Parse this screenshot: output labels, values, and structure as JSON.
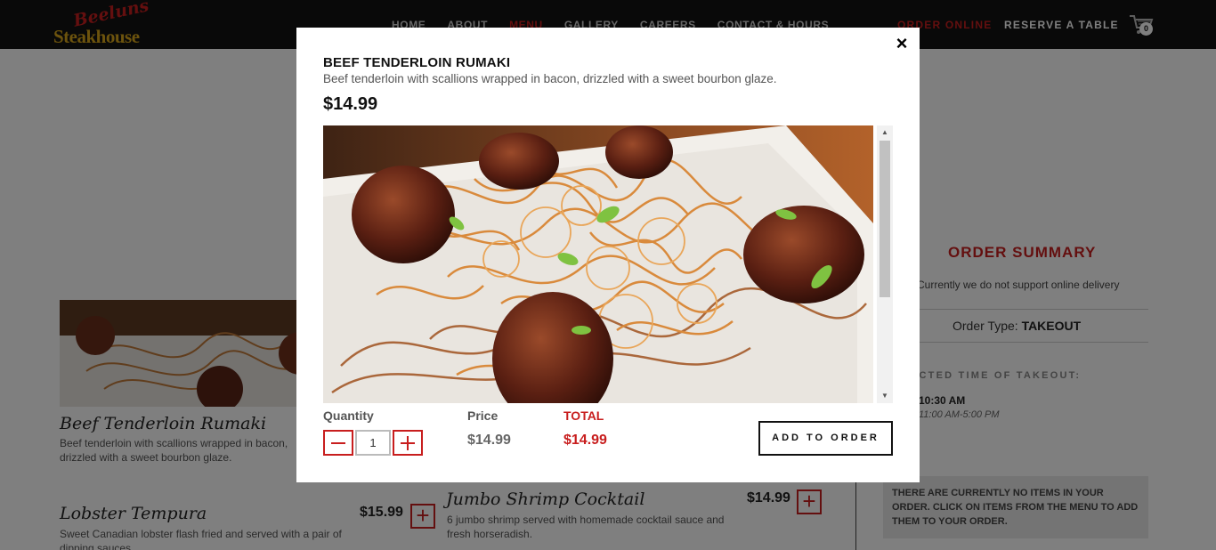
{
  "site": {
    "logo_script": "Beeluns",
    "logo_word": "Steakhouse",
    "nav": [
      "HOME",
      "ABOUT",
      "MENU",
      "GALLERY",
      "CAREERS",
      "CONTACT & HOURS"
    ],
    "nav_active": "MENU",
    "order_online": "ORDER ONLINE",
    "reserve": "RESERVE A TABLE",
    "cart_count": "0",
    "accent_color": "#c81e1e"
  },
  "menu_items": [
    {
      "title": "Beef Tenderloin Rumaki",
      "desc": "Beef tenderloin with scallions wrapped in bacon, drizzled with a sweet bourbon glaze."
    },
    {
      "title": "Lobster Tempura",
      "desc": "Sweet Canadian lobster flash fried and served with a pair of dipping sauces.",
      "price": "$15.99"
    },
    {
      "title": "Jumbo Shrimp Cocktail",
      "desc": "6 jumbo shrimp served with homemade cocktail sauce and fresh horseradish.",
      "price": "$14.99"
    }
  ],
  "summary": {
    "title": "ORDER SUMMARY",
    "note": "Currently we do not support online delivery",
    "order_type_label": "Order Type:",
    "order_type_value": "TAKEOUT",
    "takeout_label": "SELECTED TIME OF TAKEOUT:",
    "takeout_time": "10:30 AM",
    "takeout_hours": "11:00 AM-5:00 PM",
    "empty_message": "THERE ARE CURRENTLY NO ITEMS IN YOUR ORDER. CLICK ON ITEMS FROM THE MENU TO ADD THEM TO YOUR ORDER."
  },
  "modal": {
    "close": "×",
    "title": "BEEF TENDERLOIN RUMAKI",
    "description": "Beef tenderloin with scallions wrapped in bacon, drizzled with a sweet bourbon glaze.",
    "price": "$14.99",
    "quantity_label": "Quantity",
    "quantity_value": "1",
    "price_label": "Price",
    "price_value": "$14.99",
    "total_label": "TOTAL",
    "total_value": "$14.99",
    "add_button": "ADD TO ORDER"
  }
}
